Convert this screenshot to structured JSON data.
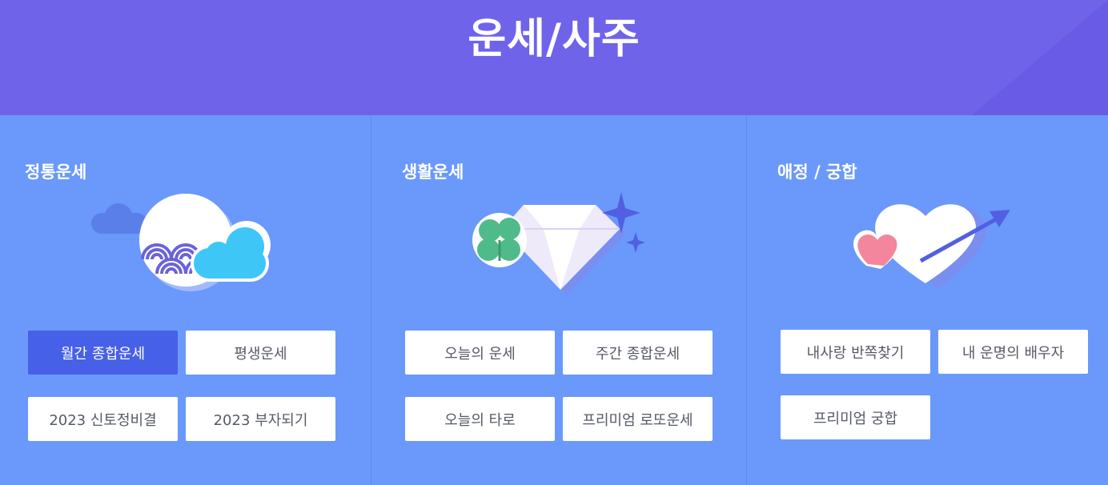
{
  "header": {
    "title": "운세/사주"
  },
  "columns": [
    {
      "title": "정통운세",
      "illustration": "moon-waves-cloud-icon",
      "buttons": [
        "월간 종합운세",
        "평생운세",
        "2023 신토정비결",
        "2023 부자되기"
      ],
      "active_index": 0
    },
    {
      "title": "생활운세",
      "illustration": "clover-diamond-sparkle-icon",
      "buttons": [
        "오늘의 운세",
        "주간 종합운세",
        "오늘의 타로",
        "프리미엄 로또운세"
      ]
    },
    {
      "title": "애정 / 궁합",
      "illustration": "hearts-arrow-icon",
      "buttons": [
        "내사랑 반쪽찾기",
        "내 운명의 배우자",
        "프리미엄 궁합"
      ]
    }
  ],
  "colors": {
    "header_bg": "#6f63e9",
    "content_bg": "#6a99fb",
    "active_button": "#4660e7",
    "button_bg": "#ffffff",
    "button_text": "#555a66"
  }
}
